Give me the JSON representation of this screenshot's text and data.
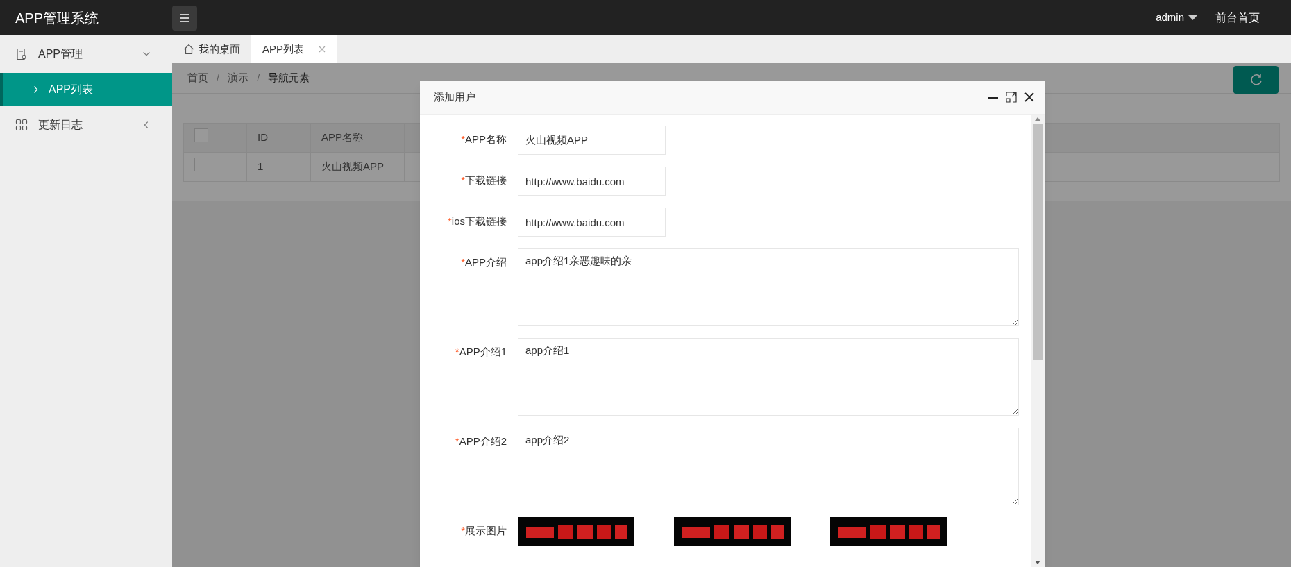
{
  "header": {
    "title": "APP管理系统",
    "user": "admin",
    "home_link": "前台首页"
  },
  "sidebar": {
    "items": [
      {
        "label": "APP管理",
        "expanded": true,
        "children": [
          {
            "label": "APP列表",
            "selected": true
          }
        ]
      },
      {
        "label": "更新日志",
        "expanded": false
      }
    ]
  },
  "tabs": [
    {
      "label": "我的桌面",
      "kind": "home",
      "selected": false
    },
    {
      "label": "APP列表",
      "kind": "closable",
      "selected": true
    }
  ],
  "breadcrumb": {
    "separator": "/",
    "items": [
      "首页",
      "演示",
      "导航元素"
    ]
  },
  "table": {
    "columns": [
      "ID",
      "APP名称"
    ],
    "header_checked": false,
    "rows": [
      {
        "checked": false,
        "cells": [
          "1",
          "火山视频APP"
        ]
      }
    ]
  },
  "dialog": {
    "title": "添加用户",
    "required_mark": "*",
    "fields": [
      {
        "label": "APP名称",
        "required": true,
        "kind": "input",
        "value": "火山视频APP"
      },
      {
        "label": "下载链接",
        "required": true,
        "kind": "input",
        "value": "http://www.baidu.com"
      },
      {
        "label": "ios下载链接",
        "required": true,
        "kind": "input",
        "value": "http://www.baidu.com"
      },
      {
        "label": "APP介绍",
        "required": true,
        "kind": "textarea",
        "value": "app介绍1亲恶趣味的亲"
      },
      {
        "label": "APP介绍1",
        "required": true,
        "kind": "textarea",
        "value": "app介绍1"
      },
      {
        "label": "APP介绍2",
        "required": true,
        "kind": "textarea",
        "value": "app介绍2"
      },
      {
        "label": "展示图片",
        "required": true,
        "kind": "images"
      }
    ]
  }
}
